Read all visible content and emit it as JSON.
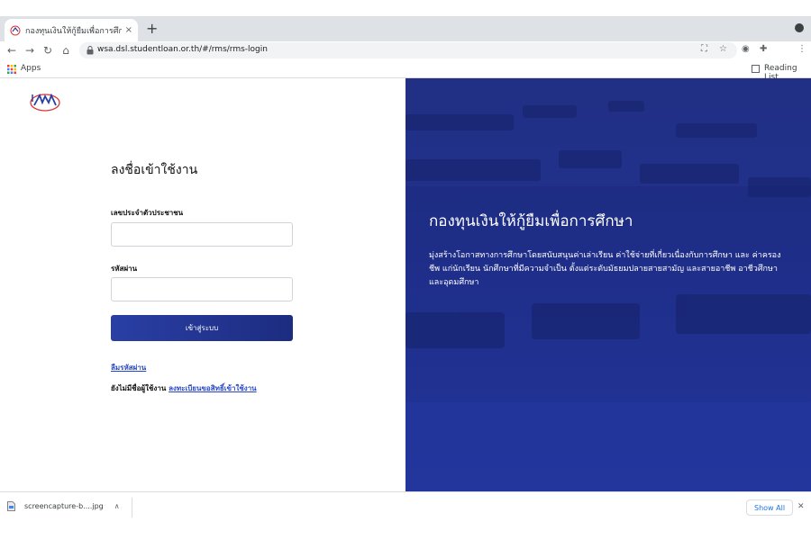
{
  "browser": {
    "tab": {
      "title": "กองทุนเงินให้กู้ยืมเพื่อการศึกษาแบบ",
      "close": "×"
    },
    "new_tab": "+",
    "url": "wsa.dsl.studentloan.or.th/#/rms/rms-login",
    "nav": {
      "back": "←",
      "forward": "→",
      "reload": "↻",
      "home": "⌂"
    },
    "bookmarks": {
      "apps_label": "Apps",
      "reading_list_label": "Reading List"
    }
  },
  "login": {
    "title": "ลงชื่อเข้าใช้งาน",
    "id_label": "เลขประจำตัวประชาชน",
    "id_value": "",
    "password_label": "รหัสผ่าน",
    "password_value": "",
    "submit_label": "เข้าสู่ระบบ",
    "forgot_password": "ลืมรหัสผ่าน",
    "no_account": "ยังไม่มีชื่อผู้ใช้งาน",
    "register_link": "ลงทะเบียนขอสิทธิ์เข้าใช้งาน"
  },
  "hero": {
    "title": "กองทุนเงินให้กู้ยืมเพื่อการศึกษา",
    "description": "มุ่งสร้างโอกาสทางการศึกษาโดยสนับสนุนค่าเล่าเรียน ค่าใช้จ่ายที่เกี่ยวเนื่องกับการศึกษา และ ค่าครองชีพ แก่นักเรียน นักศึกษาที่มีความจำเป็น ตั้งแต่ระดับมัธยมปลายสายสามัญ และสายอาชีพ อาชีวศึกษา และอุดมศึกษา"
  },
  "downloads": {
    "file_name": "screencapture-b....jpg",
    "show_all": "Show All"
  },
  "colors": {
    "brand_blue": "#1f2f8c",
    "button_gradient_start": "#2a3fa5",
    "button_gradient_end": "#1c2c80",
    "link": "#2a47c3"
  }
}
